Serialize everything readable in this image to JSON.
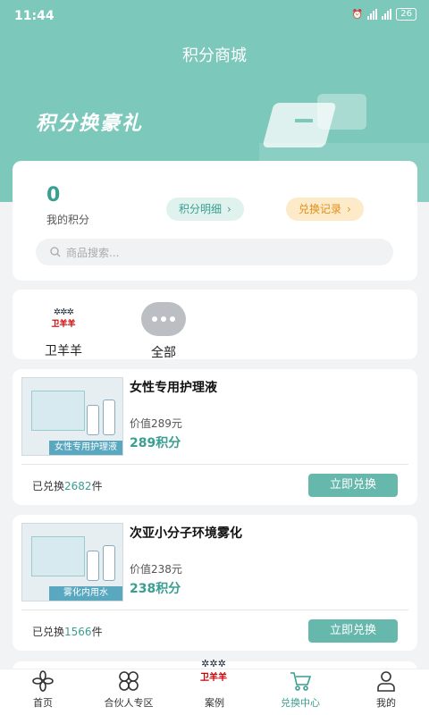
{
  "status": {
    "time": "11:44",
    "battery": "26"
  },
  "header": {
    "title": "积分商城",
    "banner_text": "积分换豪礼"
  },
  "points": {
    "value": "0",
    "label": "我的积分",
    "detail_button": "积分明细",
    "record_button": "兑换记录",
    "search_placeholder": "商品搜索..."
  },
  "categories": [
    {
      "label": "卫羊羊",
      "logo_text": "卫羊羊"
    },
    {
      "label": "全部"
    }
  ],
  "products": [
    {
      "name": "女性专用护理液",
      "price": "价值289元",
      "points": "289积分",
      "thumb_tag": "女性专用护理液",
      "redeemed_prefix": "已兑换",
      "redeemed_count": "2682",
      "redeemed_suffix": "件",
      "button": "立即兑换"
    },
    {
      "name": "次亚小分子环境雾化",
      "price": "价值238元",
      "points": "238积分",
      "thumb_tag": "雾化内用水",
      "redeemed_prefix": "已兑换",
      "redeemed_count": "1566",
      "redeemed_suffix": "件",
      "button": "立即兑换"
    }
  ],
  "tabs": [
    {
      "label": "首页",
      "icon": "home-flower-icon"
    },
    {
      "label": "合伙人专区",
      "icon": "grid-clover-icon"
    },
    {
      "label": "案例",
      "icon": "logo-icon"
    },
    {
      "label": "兑换中心",
      "icon": "cart-icon"
    },
    {
      "label": "我的",
      "icon": "user-icon"
    }
  ],
  "colors": {
    "accent": "#7cc8bb",
    "accent_text": "#3a9e90",
    "orange": "#e0901c",
    "button": "#66b8ac"
  }
}
